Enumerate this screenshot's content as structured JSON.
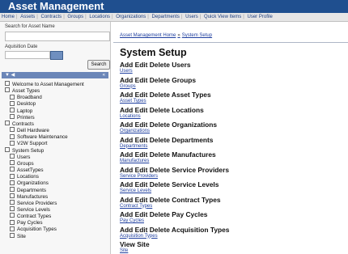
{
  "app": {
    "title": "Asset Management"
  },
  "nav": [
    "Home",
    "Assets",
    "Contracts",
    "Groups",
    "Locations",
    "Organizations",
    "Departments",
    "Users",
    "Quick View Items",
    "User Profile"
  ],
  "search": {
    "label": "Search for Asset Name",
    "acquisition_label": "Aquisition Date",
    "button": "Search"
  },
  "tree_header": {
    "left": "▼ ◀",
    "right": "«"
  },
  "tree": [
    {
      "label": "Welcome to Asset Management",
      "level": 1
    },
    {
      "label": "Asset Types",
      "level": 1
    },
    {
      "label": "Broadband",
      "level": 2
    },
    {
      "label": "Desktop",
      "level": 2
    },
    {
      "label": "Laptop",
      "level": 2
    },
    {
      "label": "Printers",
      "level": 2
    },
    {
      "label": "Contracts",
      "level": 1
    },
    {
      "label": "Dell Hardware",
      "level": 2
    },
    {
      "label": "Software Maintenance",
      "level": 2
    },
    {
      "label": "V2W Support",
      "level": 2
    },
    {
      "label": "System Setup",
      "level": 1
    },
    {
      "label": "Users",
      "level": 2
    },
    {
      "label": "Groups",
      "level": 2
    },
    {
      "label": "AssetTypes",
      "level": 2
    },
    {
      "label": "Locations",
      "level": 2
    },
    {
      "label": "Organizations",
      "level": 2
    },
    {
      "label": "Departments",
      "level": 2
    },
    {
      "label": "Manufactures",
      "level": 2
    },
    {
      "label": "Service Providers",
      "level": 2
    },
    {
      "label": "Service Levels",
      "level": 2
    },
    {
      "label": "Contract Types",
      "level": 2
    },
    {
      "label": "Pay Cycles",
      "level": 2
    },
    {
      "label": "Acquisition Types",
      "level": 2
    },
    {
      "label": "Site",
      "level": 2
    }
  ],
  "breadcrumb": {
    "home": "Asset Management Home",
    "sep": "»",
    "current": "System Setup"
  },
  "page_title": "System Setup",
  "sections": [
    {
      "title": "Add Edit Delete Users",
      "link": "Users"
    },
    {
      "title": "Add Edit Delete Groups",
      "link": "Groups"
    },
    {
      "title": "Add Edit Delete Asset Types",
      "link": "Asset Types"
    },
    {
      "title": "Add Edit Delete Locations",
      "link": "Locations"
    },
    {
      "title": "Add Edit Delete Organizations",
      "link": "Organizations"
    },
    {
      "title": "Add Edit Delete Departments",
      "link": "Departments"
    },
    {
      "title": "Add Edit Delete Manufactures",
      "link": "Manufactures"
    },
    {
      "title": "Add Edit Delete Service Providers",
      "link": "Service Providers"
    },
    {
      "title": "Add Edit Delete Service Levels",
      "link": "Service Levels"
    },
    {
      "title": "Add Edit Delete Contract Types",
      "link": "Contract Types"
    },
    {
      "title": "Add Edit Delete Pay Cycles",
      "link": "Pay Cycles"
    },
    {
      "title": "Add Edit Delete Acquisition Types",
      "link": "Acquisition Types"
    },
    {
      "title": "View Site",
      "link": "Site"
    }
  ]
}
